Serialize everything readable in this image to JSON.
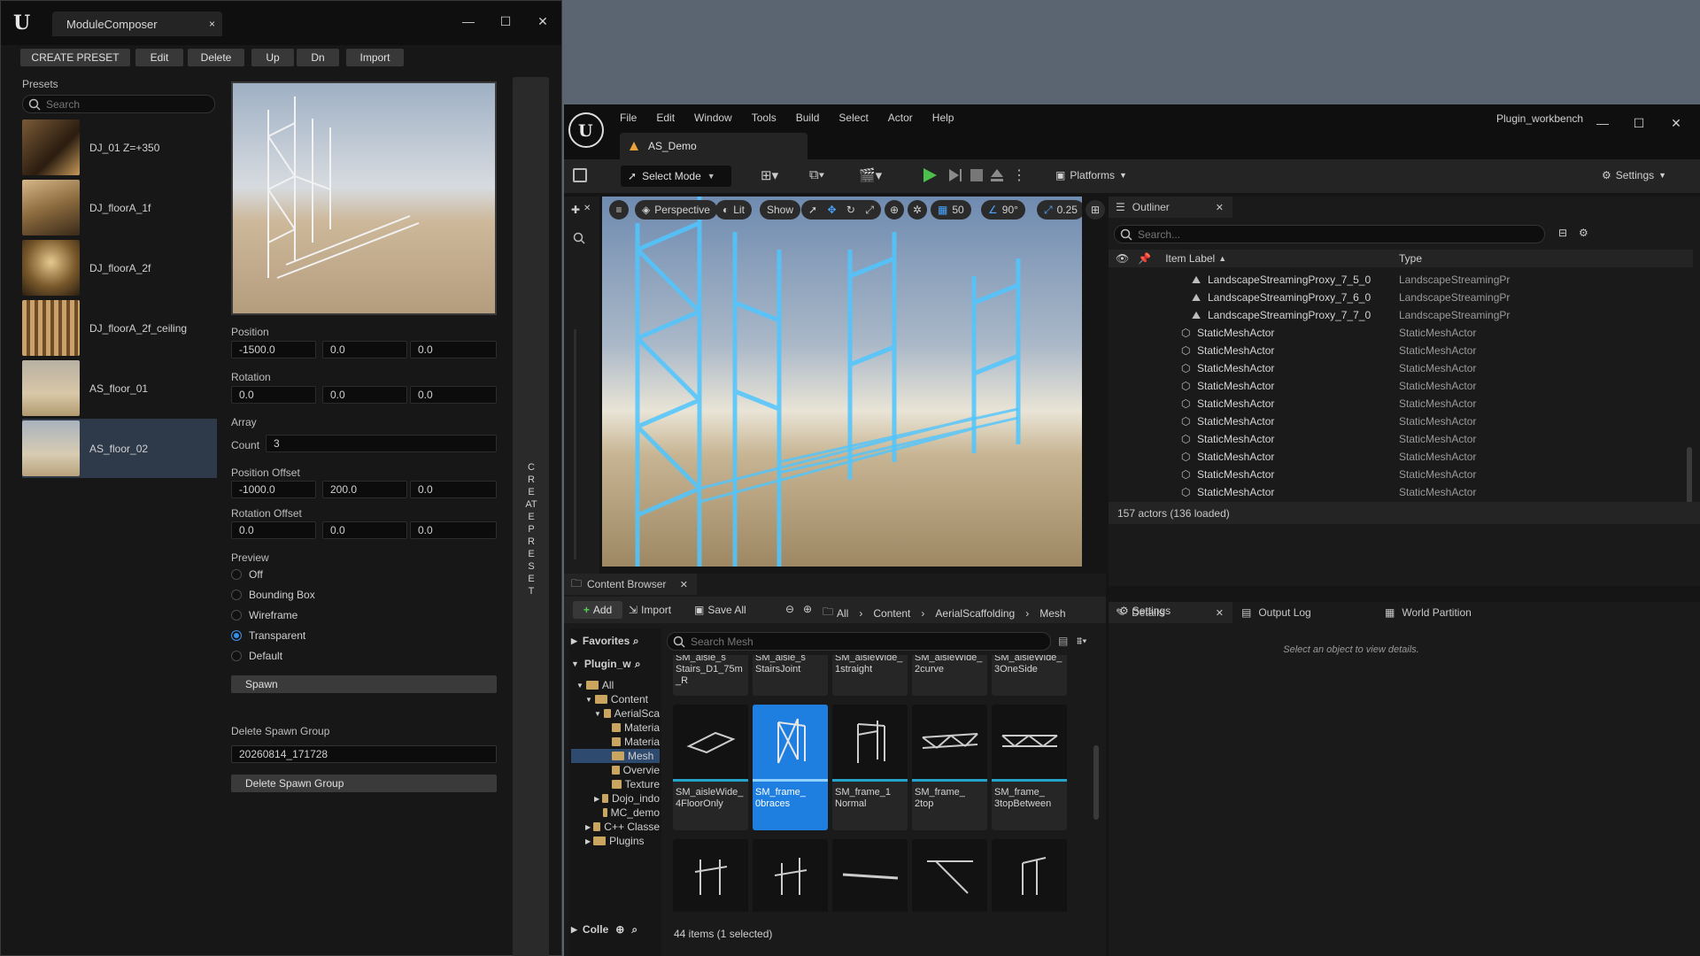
{
  "composer": {
    "title": "ModuleComposer",
    "toolbar": [
      "CREATE PRESET",
      "Edit",
      "Delete",
      "Up",
      "Dn",
      "Import"
    ],
    "presets_label": "Presets",
    "search_placeholder": "Search",
    "presets": [
      "DJ_01 Z=+350",
      "DJ_floorA_1f",
      "DJ_floorA_2f",
      "DJ_floorA_2f_ceiling",
      "AS_floor_01",
      "AS_floor_02"
    ],
    "position_label": "Position",
    "position": [
      "-1500.0",
      "0.0",
      "0.0"
    ],
    "rotation_label": "Rotation",
    "rotation": [
      "0.0",
      "0.0",
      "0.0"
    ],
    "array_label": "Array",
    "count_label": "Count",
    "count": "3",
    "pos_offset_label": "Position Offset",
    "pos_offset": [
      "-1000.0",
      "200.0",
      "0.0"
    ],
    "rot_offset_label": "Rotation Offset",
    "rot_offset": [
      "0.0",
      "0.0",
      "0.0"
    ],
    "preview_label": "Preview",
    "preview_options": [
      "Off",
      "Bounding Box",
      "Wireframe",
      "Transparent",
      "Default"
    ],
    "preview_selected": "Transparent",
    "spawn_label": "Spawn",
    "delete_group_label": "Delete Spawn Group",
    "spawn_group_value": "20260814_171728",
    "delete_group_button": "Delete Spawn Group",
    "side_button": "CREATE PRESET"
  },
  "editor": {
    "menu": [
      "File",
      "Edit",
      "Window",
      "Tools",
      "Build",
      "Select",
      "Actor",
      "Help"
    ],
    "project": "Plugin_workbench",
    "level_tab": "AS_Demo",
    "select_mode": "Select Mode",
    "platforms": "Platforms",
    "settings": "Settings",
    "viewport": {
      "perspective": "Perspective",
      "lit": "Lit",
      "show": "Show",
      "grid": "50",
      "angle": "90°",
      "scale": "0.25"
    },
    "outliner": {
      "title": "Outliner",
      "search_placeholder": "Search...",
      "col_label": "Item Label",
      "col_type": "Type",
      "rows": [
        {
          "label": "LandscapeStreamingProxy_7_5_0",
          "type": "LandscapeStreamingPr"
        },
        {
          "label": "LandscapeStreamingProxy_7_6_0",
          "type": "LandscapeStreamingPr"
        },
        {
          "label": "LandscapeStreamingProxy_7_7_0",
          "type": "LandscapeStreamingPr"
        },
        {
          "label": "StaticMeshActor",
          "type": "StaticMeshActor"
        },
        {
          "label": "StaticMeshActor",
          "type": "StaticMeshActor"
        },
        {
          "label": "StaticMeshActor",
          "type": "StaticMeshActor"
        },
        {
          "label": "StaticMeshActor",
          "type": "StaticMeshActor"
        },
        {
          "label": "StaticMeshActor",
          "type": "StaticMeshActor"
        },
        {
          "label": "StaticMeshActor",
          "type": "StaticMeshActor"
        },
        {
          "label": "StaticMeshActor",
          "type": "StaticMeshActor"
        },
        {
          "label": "StaticMeshActor",
          "type": "StaticMeshActor"
        },
        {
          "label": "StaticMeshActor",
          "type": "StaticMeshActor"
        },
        {
          "label": "StaticMeshActor",
          "type": "StaticMeshActor"
        },
        {
          "label": "StaticMeshActor",
          "type": "StaticMeshActor"
        },
        {
          "label": "StaticMeshActor",
          "type": "StaticMeshActor"
        },
        {
          "label": "StaticMeshActor",
          "type": "StaticMeshActor"
        },
        {
          "label": "StaticMeshActor",
          "type": "StaticMeshActor"
        }
      ],
      "status": "157 actors (136 loaded)"
    },
    "details": {
      "title": "Details",
      "output_log": "Output Log",
      "world_partition": "World Partition",
      "empty": "Select an object to view details."
    },
    "content_browser": {
      "title": "Content Browser",
      "add": "Add",
      "import": "Import",
      "save_all": "Save All",
      "breadcrumb": [
        "All",
        "Content",
        "AerialScaffolding",
        "Mesh"
      ],
      "settings": "Settings",
      "favorites": "Favorites",
      "project": "Plugin_w",
      "collections": "Colle",
      "search_placeholder": "Search Mesh",
      "tree": [
        "All",
        "Content",
        "AerialSca",
        "Materia",
        "Materia",
        "Mesh",
        "Overvie",
        "Texture",
        "Dojo_indo",
        "MC_demo",
        "C++ Classe",
        "Plugins"
      ],
      "top_row": [
        "SM_aisle_s\nStairs_D1_75m\n_R",
        "SM_aisle_s\nStairsJoint",
        "SM_aisleWide_\n1straight",
        "SM_aisleWide_\n2curve",
        "SM_aisleWide_\n3OneSide"
      ],
      "mid_row": [
        "SM_aisleWide_\n4FloorOnly",
        "SM_frame_\n0braces",
        "SM_frame_1\nNormal",
        "SM_frame_\n2top",
        "SM_frame_\n3topBetween"
      ],
      "status": "44 items (1 selected)"
    }
  }
}
